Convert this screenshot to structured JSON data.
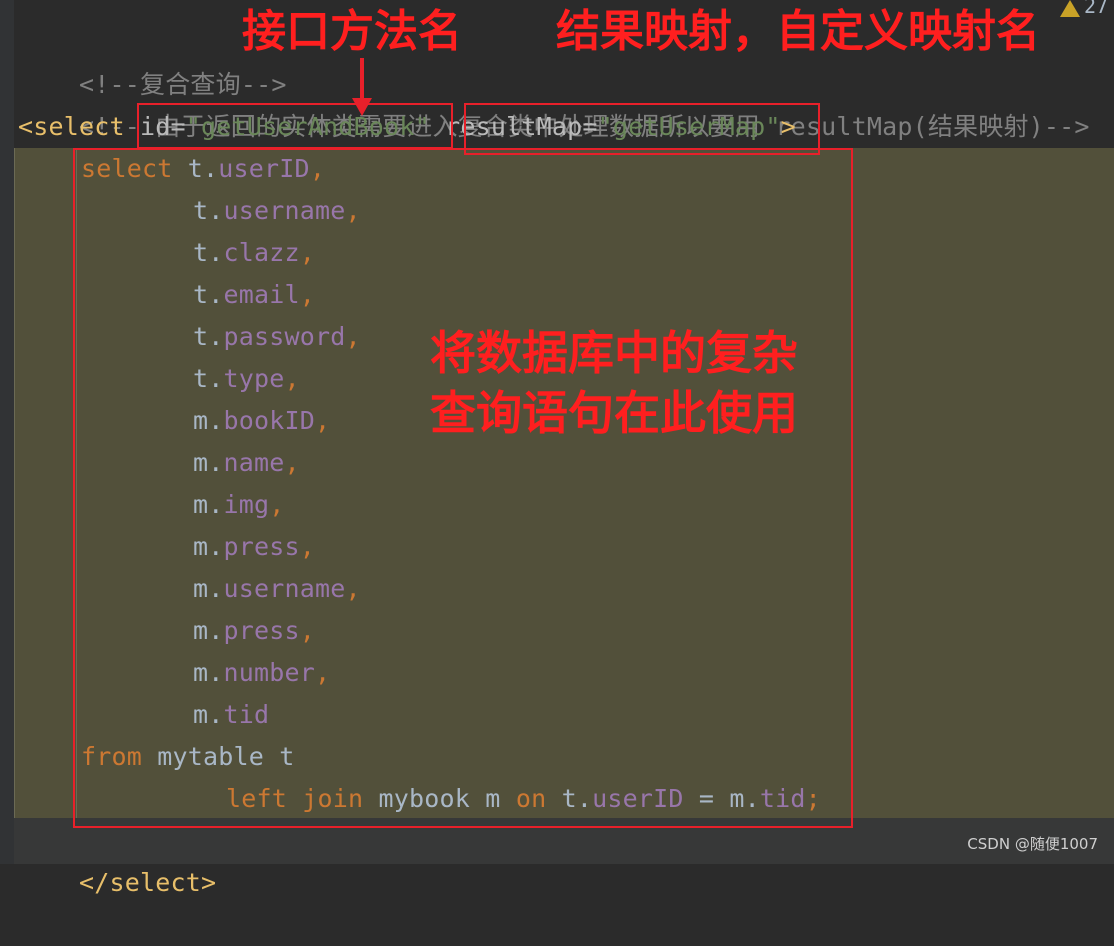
{
  "editor": {
    "warning_count": "27",
    "lines": {
      "comment1": "<!--复合查询-->",
      "comment2": "<!-- 由于返回的实体类需要进入复合类中处理数据所以要用 resultMap(结果映射)-->",
      "select_open_tag": "<select",
      "id_attr": "id=",
      "id_value": "\"getUserAndBook\"",
      "resultmap_attr": "resultMap=",
      "resultmap_value": "\"getUserMap\"",
      "tag_close": ">",
      "sql_select_kw": "select",
      "fields": [
        {
          "prefix": "t.",
          "name": "userID",
          "suffix": ","
        },
        {
          "prefix": "t.",
          "name": "username",
          "suffix": ","
        },
        {
          "prefix": "t.",
          "name": "clazz",
          "suffix": ","
        },
        {
          "prefix": "t.",
          "name": "email",
          "suffix": ","
        },
        {
          "prefix": "t.",
          "name": "password",
          "suffix": ","
        },
        {
          "prefix": "t.",
          "name": "type",
          "suffix": ","
        },
        {
          "prefix": "m.",
          "name": "bookID",
          "suffix": ","
        },
        {
          "prefix": "m.",
          "name": "name",
          "suffix": ","
        },
        {
          "prefix": "m.",
          "name": "img",
          "suffix": ","
        },
        {
          "prefix": "m.",
          "name": "press",
          "suffix": ","
        },
        {
          "prefix": "m.",
          "name": "username",
          "suffix": ","
        },
        {
          "prefix": "m.",
          "name": "press",
          "suffix": ","
        },
        {
          "prefix": "m.",
          "name": "number",
          "suffix": ","
        },
        {
          "prefix": "m.",
          "name": "tid",
          "suffix": ""
        }
      ],
      "from_kw": "from",
      "from_table": " mytable t",
      "left_kw": "left",
      "join_kw": "join",
      "join_table": " mybook m ",
      "on_kw": "on",
      "join_cond_a": " t.",
      "join_cond_field_a": "userID",
      "join_cond_eq": " = m.",
      "join_cond_field_b": "tid",
      "semicolon": ";",
      "select_close_tag": "</select>"
    }
  },
  "annotations": {
    "interface_method_name": "接口方法名",
    "result_mapping": "结果映射，自定义映射名",
    "complex_query_line1": "将数据库中的复杂",
    "complex_query_line2": "查询语句在此使用"
  },
  "watermark": "CSDN @随便1007",
  "colors": {
    "background": "#2b2b2b",
    "block_highlight": "#52503a",
    "annotation_red": "#ff1f1f",
    "tag": "#e8bf6a",
    "string": "#6a8759",
    "keyword": "#cc7832",
    "field": "#9876aa",
    "comment": "#808080"
  }
}
